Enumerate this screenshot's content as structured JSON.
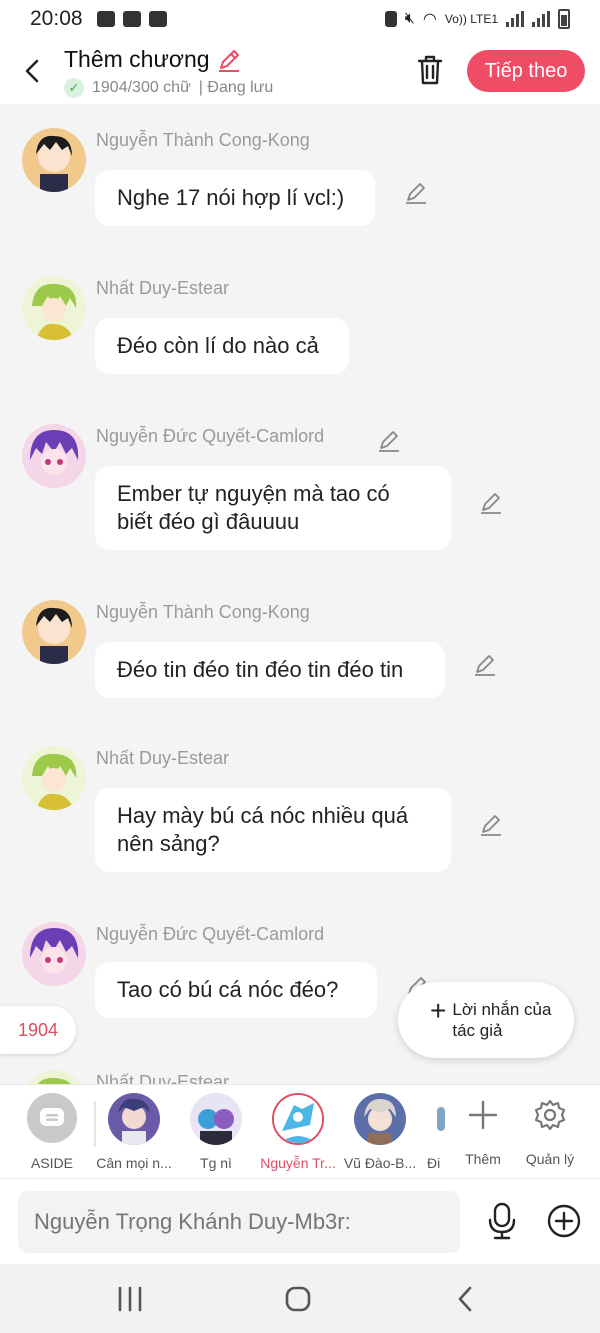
{
  "status": {
    "time": "20:08",
    "network": "Vo)) LTE1"
  },
  "header": {
    "title": "Thêm chương",
    "word_count": "1904/300 chữ",
    "save_state": "| Đang lưu",
    "next_label": "Tiếp theo",
    "accent": "#ef4d66"
  },
  "messages": [
    {
      "sender": "Nguyễn Thành Cong-Kong",
      "text": "Nghe 17 nói hợp lí vcl:)"
    },
    {
      "sender": "Nhất Duy-Estear",
      "text": "Đéo còn lí do nào cả"
    },
    {
      "sender": "Nguyễn Đức Quyết-Camlord",
      "text": "Ember tự nguyện mà tao có biết đéo gì đâuuuu"
    },
    {
      "sender": "Nguyễn Thành Cong-Kong",
      "text": "Đéo tin đéo tin đéo tin đéo tin"
    },
    {
      "sender": "Nhất Duy-Estear",
      "text": "Hay mày bú cá nóc nhiều quá nên sảng?"
    },
    {
      "sender": "Nguyễn Đức Quyết-Camlord",
      "text": "Tao có bú cá nóc đéo?"
    },
    {
      "sender": "Nhất Duy-Estear",
      "text": ""
    }
  ],
  "floating": {
    "counter": "1904",
    "author_note": "Lời nhắn của tác giả"
  },
  "characters": [
    {
      "name": "ASIDE",
      "icon": "chat-bubble-icon"
    },
    {
      "name": "Cân mọi n...",
      "active": false
    },
    {
      "name": "Tg nì",
      "active": false
    },
    {
      "name": "Nguyễn Tr...",
      "active": true
    },
    {
      "name": "Vũ Đào-B...",
      "active": false
    },
    {
      "name": "Đi",
      "active": false
    }
  ],
  "tools": {
    "add_label": "Thêm",
    "manage_label": "Quản lý"
  },
  "composer": {
    "placeholder": "Nguyễn Trọng Khánh Duy-Mb3r:"
  }
}
